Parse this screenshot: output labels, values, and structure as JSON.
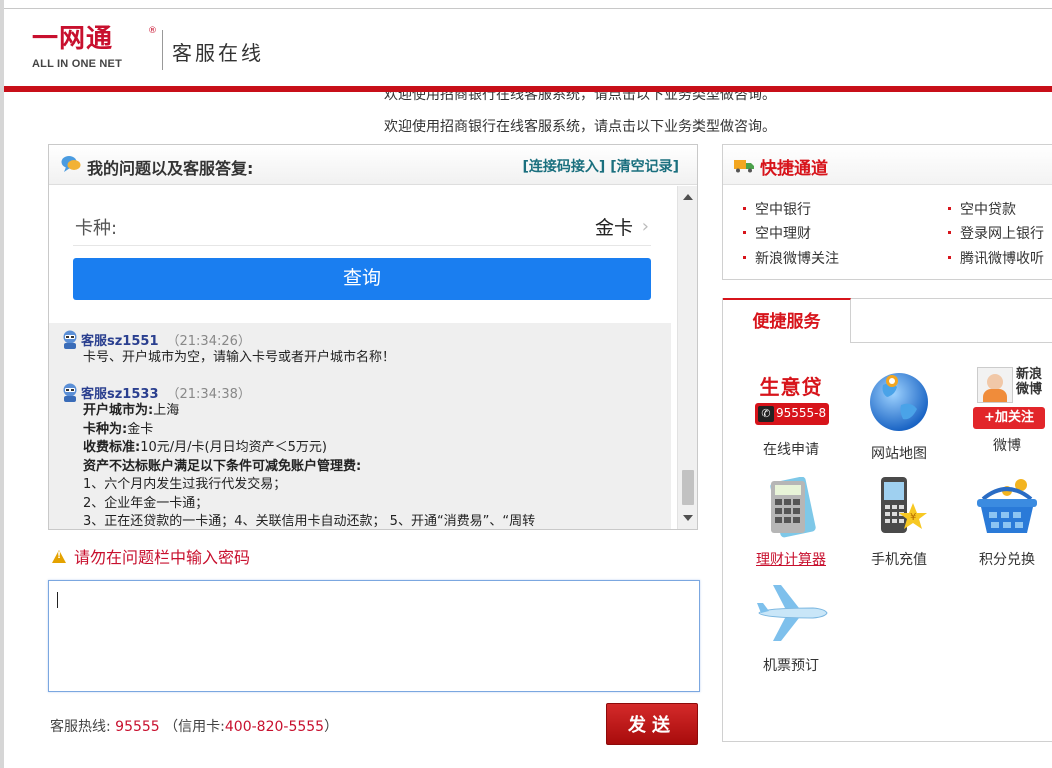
{
  "header": {
    "logo_text": "一网通",
    "logo_reg": "®",
    "logo_sub": "ALL IN ONE NET",
    "service_title": "客服在线"
  },
  "marquee": {
    "line1": "欢迎使用招商银行在线客服系统，请点击以下业务类型做咨询。",
    "line2": "欢迎使用招商银行在线客服系统，请点击以下业务类型做咨询。"
  },
  "chat": {
    "title": "我的问题以及客服答复:",
    "link_connect": "[连接码接入]",
    "link_clear": "[清空记录]",
    "card_label": "卡种:",
    "card_value": "金卡",
    "query_button": "查询",
    "messages": [
      {
        "name": "客服sz1551",
        "time": "（21:34:26）",
        "text": "卡号、开户城市为空，请输入卡号或者开户城市名称！"
      },
      {
        "name": "客服sz1533",
        "time": "（21:34:38）",
        "lines": [
          {
            "label": "开户城市为:",
            "value": "上海"
          },
          {
            "label": "卡种为:",
            "value": "金卡"
          },
          {
            "label": "收费标准:",
            "value": "10元/月/卡(月日均资产＜5万元)"
          },
          {
            "label": "资产不达标账户满足以下条件可减免账户管理费:",
            "value": ""
          }
        ],
        "items": [
          "1、六个月内发生过我行代发交易；",
          "2、企业年金一卡通；",
          "3、正在还贷款的一卡通；4、关联信用卡自动还款；  5、开通“消费易”、“周转"
        ]
      }
    ]
  },
  "warning": "请勿在问题栏中输入密码",
  "input": {
    "value": "",
    "placeholder": ""
  },
  "footer": {
    "hotline_label": "客服热线:",
    "hotline_number": "95555",
    "credit_label": "（信用卡:",
    "credit_number": "400-820-5555",
    "credit_close": "）",
    "send_button": "发送"
  },
  "quick": {
    "title": "快捷通道",
    "items": [
      "空中银行",
      "空中贷款",
      "空中理财",
      "登录网上银行",
      "新浪微博关注",
      "腾讯微博收听"
    ]
  },
  "service": {
    "tab": "便捷服务",
    "items": [
      {
        "label": "在线申请",
        "icon": "shengyidai-icon",
        "badge_title": "生意贷",
        "badge_phone": "95555-8"
      },
      {
        "label": "网站地图",
        "icon": "globe-icon"
      },
      {
        "label": "微博",
        "icon": "weibo-icon",
        "badge_title": "新浪微博",
        "badge_follow": "+加关注"
      },
      {
        "label": "理财计算器",
        "icon": "calculator-icon"
      },
      {
        "label": "手机充值",
        "icon": "phone-recharge-icon"
      },
      {
        "label": "积分兑换",
        "icon": "basket-icon"
      },
      {
        "label": "机票预订",
        "icon": "airplane-icon"
      }
    ]
  },
  "colors": {
    "brand_red": "#c80f19",
    "link_teal": "#1a6f7e",
    "query_blue": "#1a7ef0",
    "agent_name": "#2a3f8f"
  }
}
